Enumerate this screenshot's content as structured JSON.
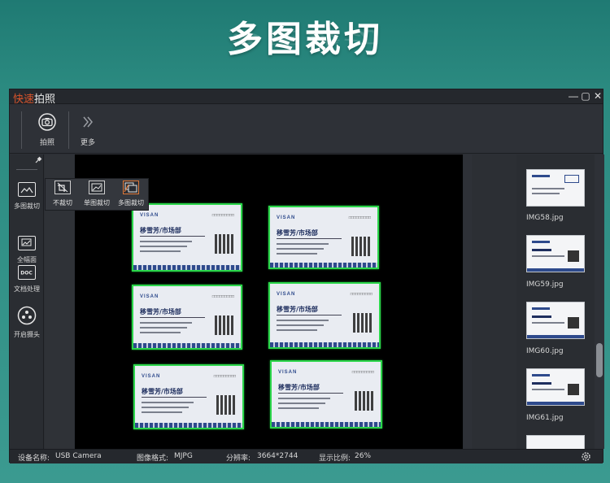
{
  "banner": {
    "title": "多图裁切"
  },
  "app": {
    "title_part1": "快速",
    "title_part2": "拍照",
    "minimize": "—",
    "restore": "▢",
    "close": "✕"
  },
  "toolbar": {
    "capture_label": "拍照",
    "more_label": "更多"
  },
  "left_panel": {
    "items": [
      {
        "label": "多图裁切",
        "icon": "multi-crop-icon"
      },
      {
        "label": "全幅面",
        "icon": "full-frame-icon"
      },
      {
        "label": "文档处理",
        "icon": "doc-icon"
      },
      {
        "label": "开启摄头",
        "icon": "camera-lens-icon"
      }
    ]
  },
  "crop_panel": {
    "items": [
      {
        "label": "不裁切",
        "icon": "no-crop-icon"
      },
      {
        "label": "单图裁切",
        "icon": "single-crop-icon"
      },
      {
        "label": "多图裁切",
        "icon": "multi-crop-icon"
      }
    ]
  },
  "cards": [
    {
      "brand": "VISAN",
      "name": "移雪芳/市场部"
    },
    {
      "brand": "VISAN",
      "name": "移雪芳/市场部"
    },
    {
      "brand": "VISAN",
      "name": "移雪芳/市场部"
    },
    {
      "brand": "VISAN",
      "name": "移雪芳/市场部"
    },
    {
      "brand": "VISAN",
      "name": "移雪芳/市场部"
    },
    {
      "brand": "VISAN",
      "name": "移雪芳/市场部"
    }
  ],
  "thumbnails": [
    {
      "label": "IMG58.jpg"
    },
    {
      "label": "IMG59.jpg"
    },
    {
      "label": "IMG60.jpg"
    },
    {
      "label": "IMG61.jpg"
    }
  ],
  "status": {
    "device_label": "设备名称:",
    "device_value": "USB Camera",
    "format_label": "图像格式:",
    "format_value": "MJPG",
    "resolution_label": "分辨率:",
    "resolution_value": "3664*2744",
    "ratio_label": "显示比例:",
    "ratio_value": "26%"
  },
  "colors": {
    "banner_bg": "#2b8a80",
    "accent_orange": "#d9542b",
    "crop_green": "#2bd64a"
  }
}
